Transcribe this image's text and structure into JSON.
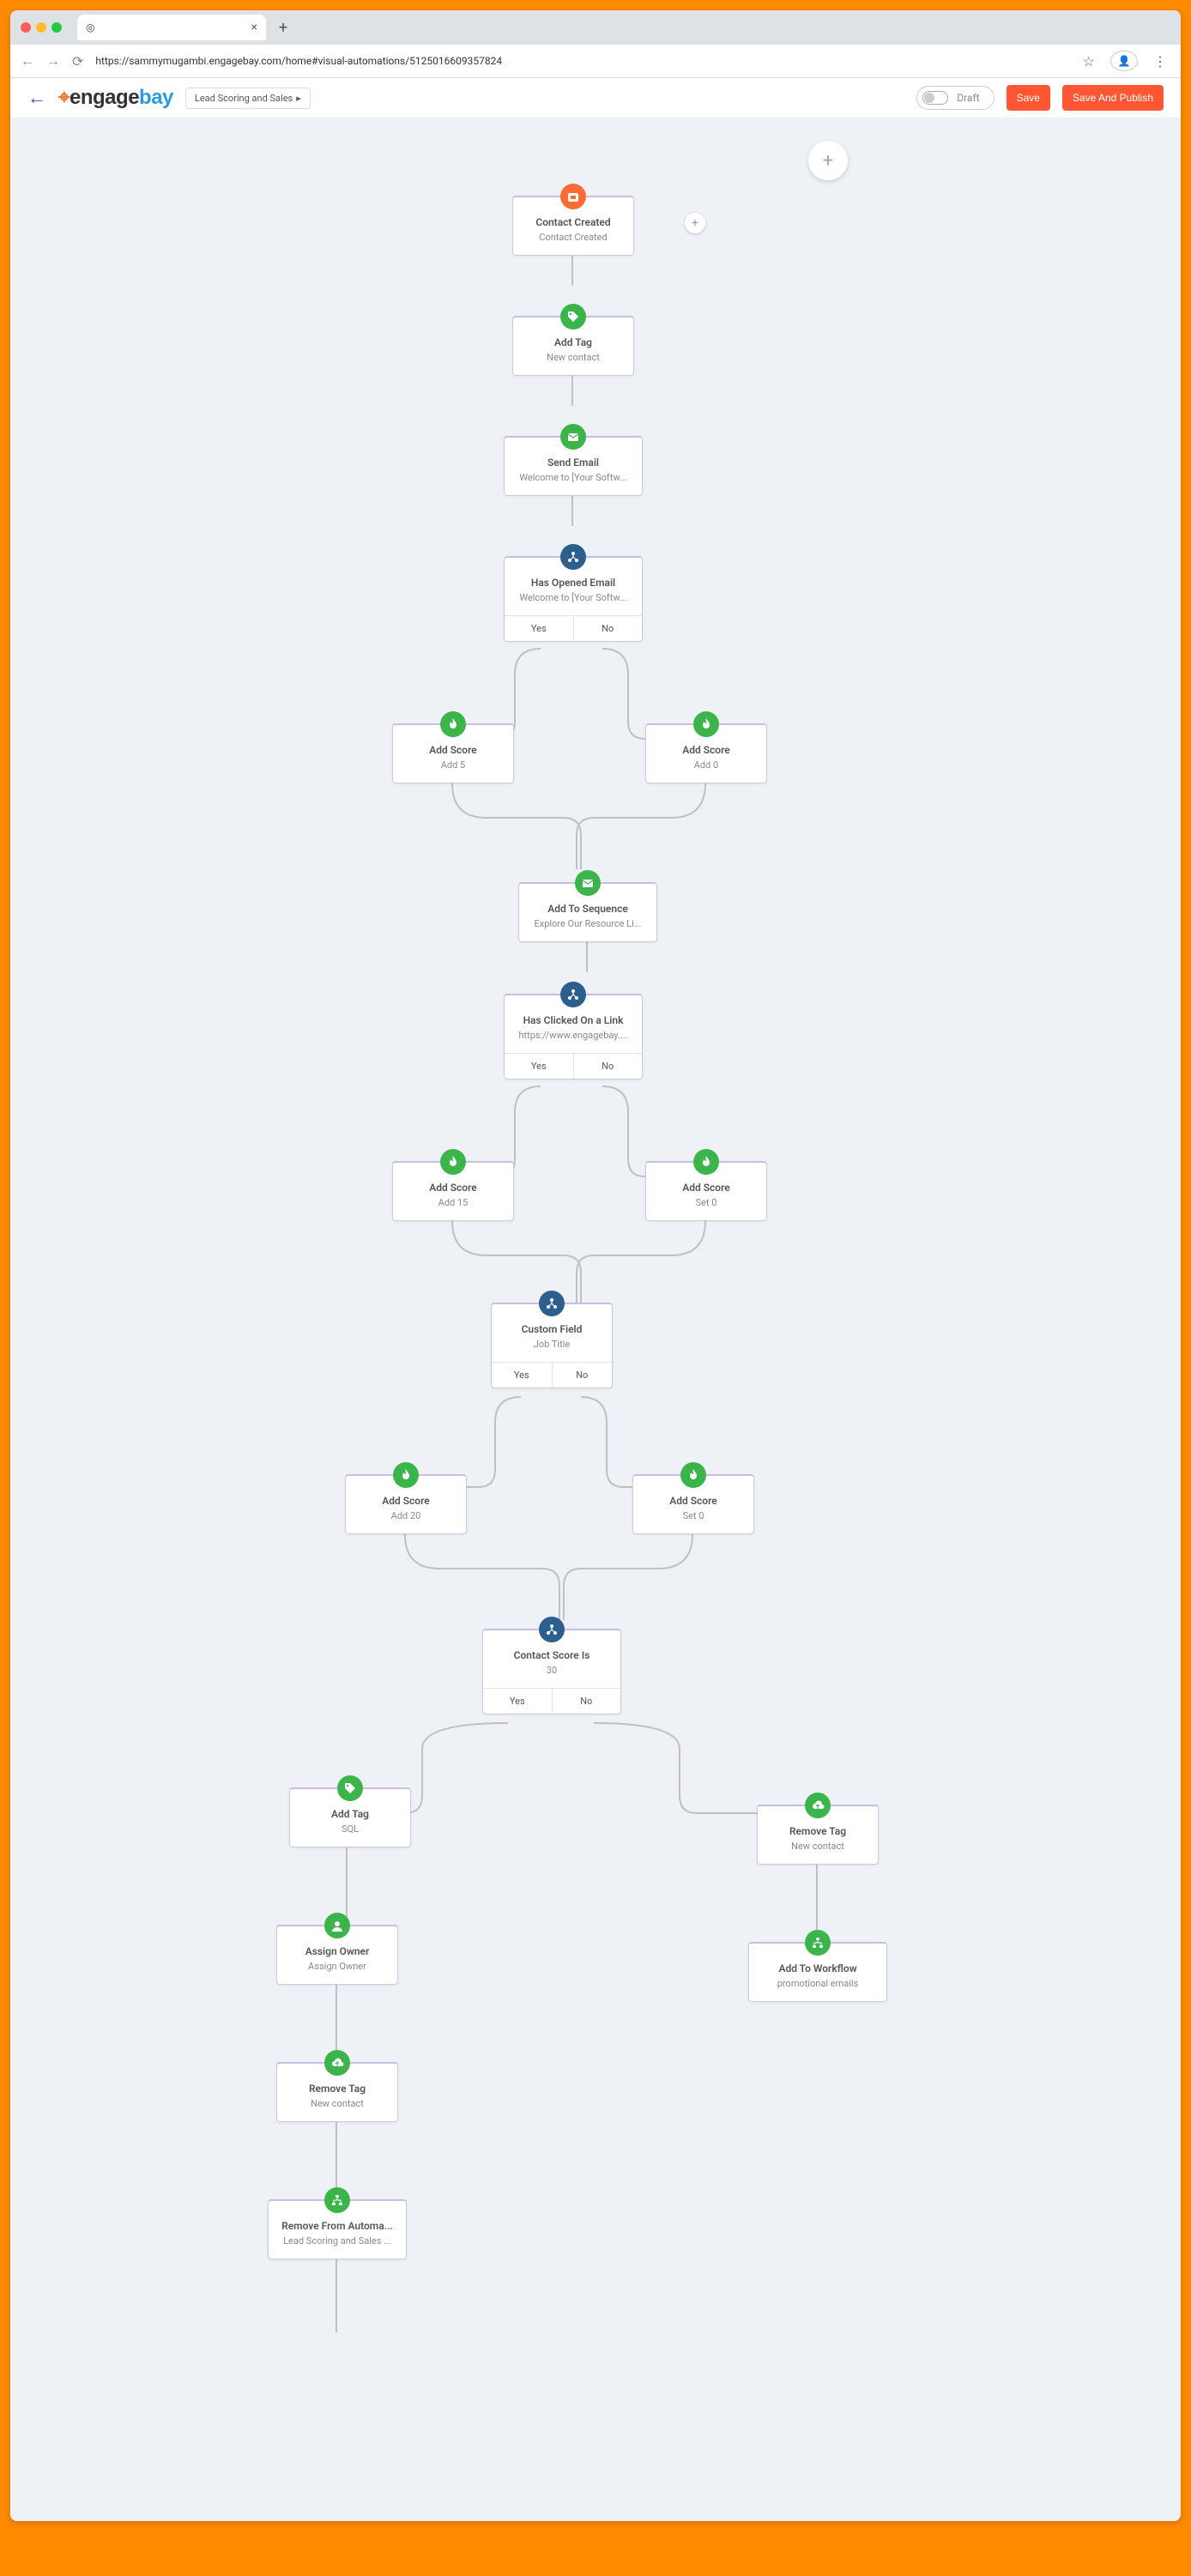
{
  "browser": {
    "url": "https://sammymugambi.engagebay.com/home#visual-automations/5125016609357824",
    "tab_title": " "
  },
  "header": {
    "logo_pre": "engage",
    "logo_post": "bay",
    "breadcrumb": "Lead Scoring and Sales ",
    "draft": "Draft",
    "save": "Save",
    "publish": "Save And Publish"
  },
  "labels": {
    "yes": "Yes",
    "no": "No"
  },
  "nodes": {
    "n1": {
      "title": "Contact Created",
      "desc": "Contact Created"
    },
    "n2": {
      "title": "Add Tag",
      "desc": "New contact"
    },
    "n3": {
      "title": "Send Email",
      "desc": "Welcome to [Your Softw..."
    },
    "n4": {
      "title": "Has Opened Email",
      "desc": "Welcome to [Your Softw..."
    },
    "n5": {
      "title": "Add Score",
      "desc": "Add 5"
    },
    "n6": {
      "title": "Add Score",
      "desc": "Add 0"
    },
    "n7": {
      "title": "Add To Sequence",
      "desc": "Explore Our Resource Li..."
    },
    "n8": {
      "title": "Has Clicked On a Link",
      "desc": "https://www.engagebay...."
    },
    "n9": {
      "title": "Add Score",
      "desc": "Add 15"
    },
    "n10": {
      "title": "Add Score",
      "desc": "Set 0"
    },
    "n11": {
      "title": "Custom Field",
      "desc": "Job Title"
    },
    "n12": {
      "title": "Add Score",
      "desc": "Add 20"
    },
    "n13": {
      "title": "Add Score",
      "desc": "Set 0"
    },
    "n14": {
      "title": "Contact Score Is",
      "desc": "30"
    },
    "n15": {
      "title": "Add Tag",
      "desc": "SQL"
    },
    "n16": {
      "title": "Remove Tag",
      "desc": "New contact"
    },
    "n17": {
      "title": "Assign Owner",
      "desc": "Assign Owner"
    },
    "n18": {
      "title": "Add To Workflow",
      "desc": "promotional emails"
    },
    "n19": {
      "title": "Remove Tag",
      "desc": "New contact"
    },
    "n20": {
      "title": "Remove From Automa...",
      "desc": "Lead Scoring and Sales ..."
    }
  }
}
